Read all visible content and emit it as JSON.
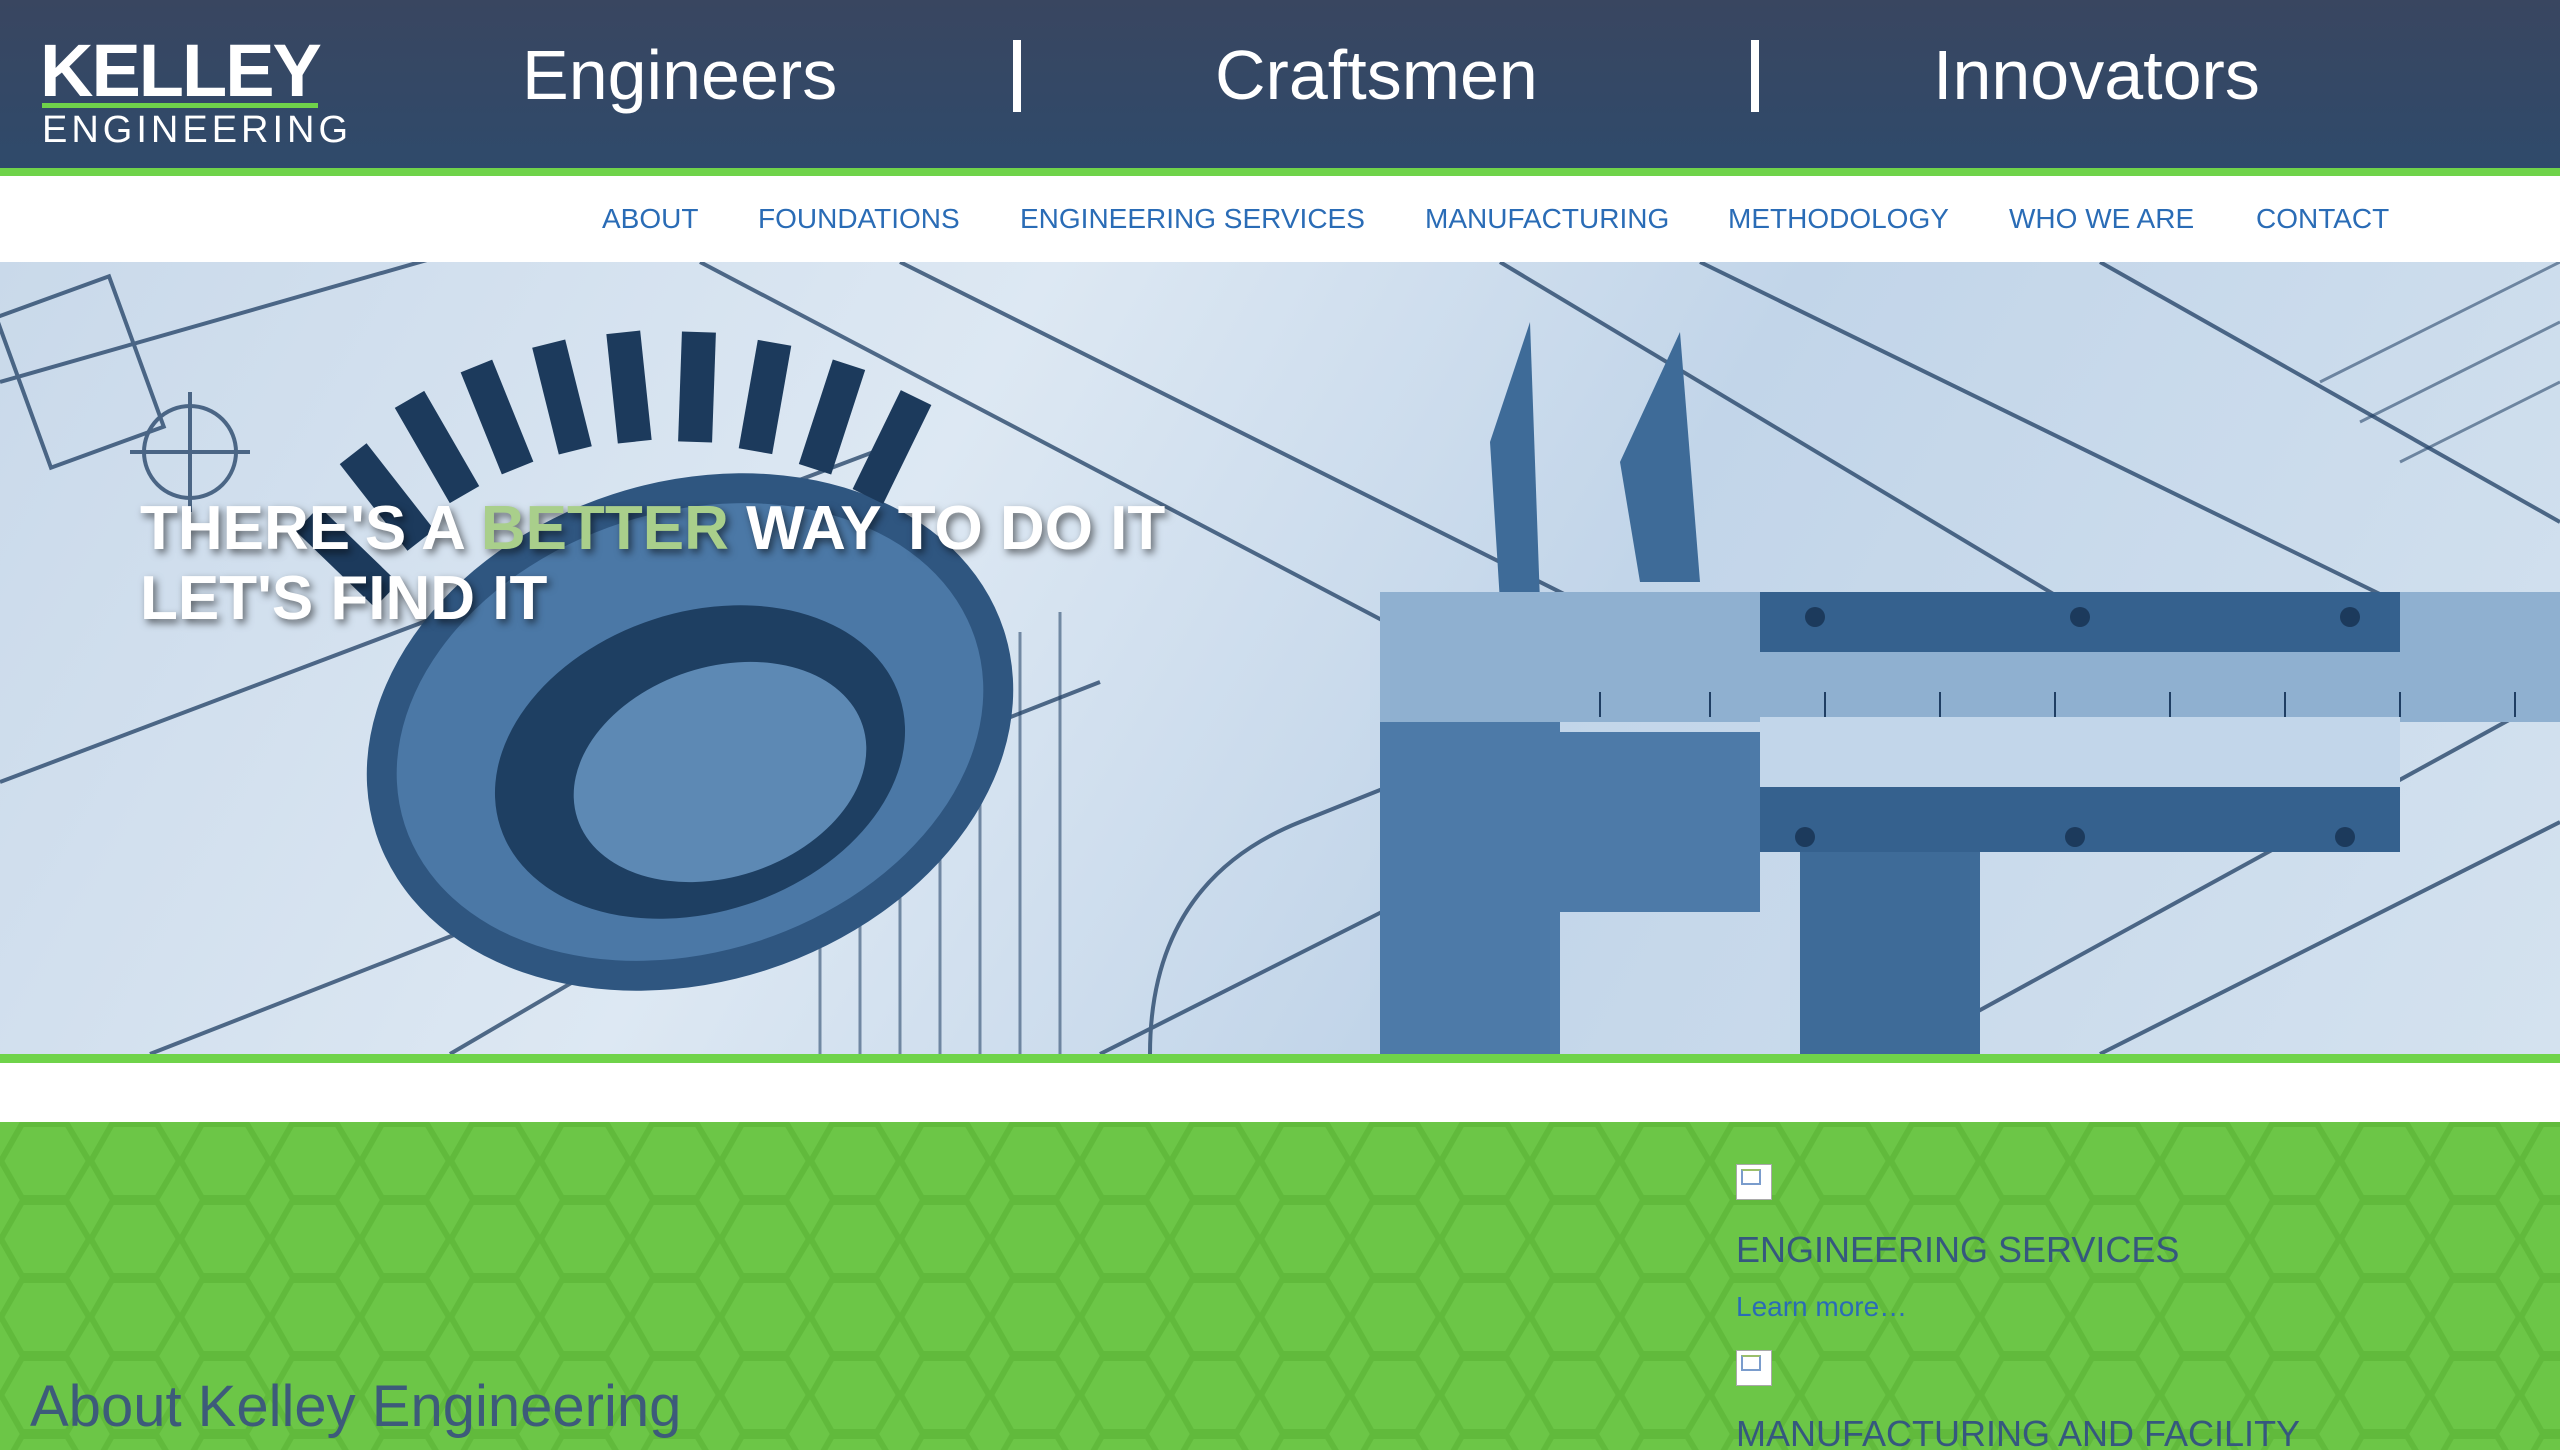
{
  "header": {
    "logo_top": "KELLEY",
    "logo_bottom": "ENGINEERING",
    "slogans": [
      "Engineers",
      "Craftsmen",
      "Innovators"
    ],
    "separator": "|"
  },
  "nav": {
    "items": [
      "ABOUT",
      "FOUNDATIONS",
      "ENGINEERING SERVICES",
      "MANUFACTURING",
      "METHODOLOGY",
      "WHO WE ARE",
      "CONTACT"
    ]
  },
  "hero": {
    "line1_prefix": "THERE'S A ",
    "line1_accent": "BETTER",
    "line1_suffix": " WAY TO DO IT",
    "line2": "LET'S FIND IT"
  },
  "main": {
    "about_title": "About Kelley Engineering",
    "services": [
      {
        "title": "ENGINEERING SERVICES",
        "link": "Learn more…",
        "image": "broken-image-icon"
      },
      {
        "title": "MANUFACTURING AND FACILITY",
        "link": "",
        "image": "broken-image-icon"
      }
    ]
  },
  "colors": {
    "header_bg": "#394660",
    "accent_green": "#6fd34a",
    "nav_link": "#2a6cb6",
    "section_green": "#6cc647",
    "headline_accent": "#a9cf8b"
  }
}
